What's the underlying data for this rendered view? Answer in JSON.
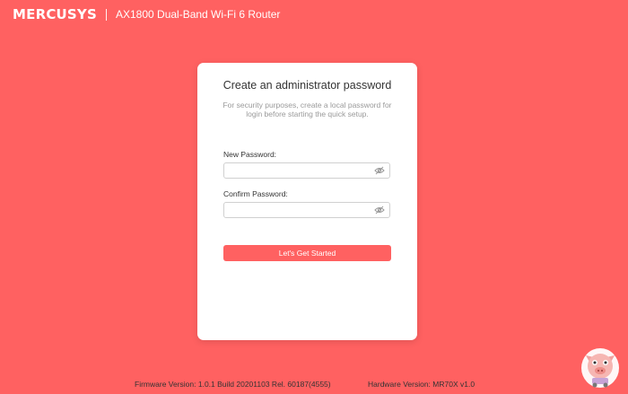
{
  "header": {
    "logo": "MERCUSYS",
    "model": "AX1800 Dual-Band Wi-Fi 6 Router"
  },
  "card": {
    "title": "Create an administrator password",
    "description": "For security purposes, create a local password for login before starting the quick setup.",
    "new_password_label": "New Password:",
    "new_password_value": "",
    "confirm_password_label": "Confirm Password:",
    "confirm_password_value": "",
    "submit_label": "Let's Get Started"
  },
  "footer": {
    "firmware": "Firmware Version: 1.0.1 Build 20201103 Rel. 60187(4555)",
    "hardware": "Hardware Version: MR70X v1.0"
  },
  "colors": {
    "background": "#ff6161",
    "button": "#ff6161",
    "card": "#ffffff"
  },
  "icons": [
    "eye-hidden-icon",
    "mascot-logo"
  ]
}
